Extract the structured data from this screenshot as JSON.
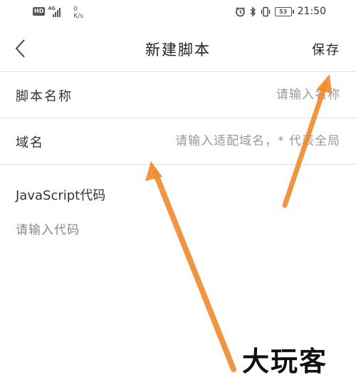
{
  "status_bar": {
    "hd_badge": "HD",
    "network_type": "4G",
    "speed_value": "0",
    "speed_unit": "K/s",
    "battery_level": "53",
    "time": "21:50"
  },
  "header": {
    "back_icon": "chevron-left-icon",
    "title": "新建脚本",
    "save_label": "保存"
  },
  "form": {
    "script_name": {
      "label": "脚本名称",
      "placeholder": "请输入名称",
      "value": ""
    },
    "domain": {
      "label": "域名",
      "placeholder": "请输入适配域名，* 代表全局",
      "value": ""
    },
    "code": {
      "label": "JavaScript代码",
      "placeholder": "请输入代码",
      "value": ""
    }
  },
  "annotation": {
    "arrow_color": "#f08a2c",
    "watermark": "大玩客"
  },
  "colors": {
    "divider": "#e0e0e0",
    "placeholder": "#999999"
  }
}
